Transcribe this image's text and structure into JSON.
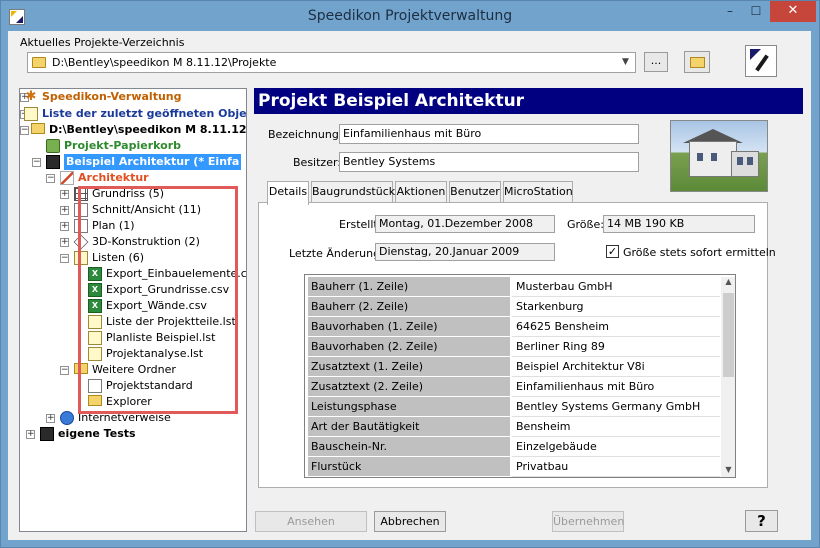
{
  "window": {
    "title": "Speedikon Projektverwaltung",
    "minimize": "–",
    "maximize": "☐",
    "close": "✕"
  },
  "directory": {
    "label": "Aktuelles Projekte-Verzeichnis",
    "path": "D:\\Bentley\\speedikon M 8.11.12\\Projekte",
    "browse_label": "..."
  },
  "tree": {
    "nodes": [
      {
        "label": "Speedikon-Verwaltung",
        "color": "#c06000",
        "bold": true,
        "icon": "star-icon",
        "expander": "+"
      },
      {
        "label": "Liste der zuletzt geöffneten Obje",
        "color": "#1a3a9a",
        "bold": true,
        "icon": "recent-list-icon",
        "expander": "+"
      },
      {
        "label": "D:\\Bentley\\speedikon M 8.11.12",
        "color": "#000000",
        "bold": true,
        "icon": "folder-icon",
        "expander": "−"
      },
      {
        "label": "Projekt-Papierkorb",
        "color": "#2e8a2e",
        "bold": true,
        "icon": "basket-icon",
        "expander": ""
      },
      {
        "label": "Beispiel Architektur   (* Einfa",
        "color": "#ffffff",
        "bold": true,
        "icon": "book-icon",
        "expander": "−",
        "selected": true
      },
      {
        "label": "Architektur",
        "color": "#e05020",
        "bold": true,
        "icon": "pen-icon",
        "expander": "−"
      },
      {
        "label": "Grundriss (5)",
        "icon": "floorplan-icon",
        "expander": "+"
      },
      {
        "label": "Schnitt/Ansicht (11)",
        "icon": "section-icon",
        "expander": "+"
      },
      {
        "label": "Plan (1)",
        "icon": "plan-icon",
        "expander": "+"
      },
      {
        "label": "3D-Konstruktion (2)",
        "icon": "cube-icon",
        "expander": "+"
      },
      {
        "label": "Listen  (6)",
        "icon": "list-folder-icon",
        "expander": "−"
      },
      {
        "label": "Export_Einbauelemente.csv",
        "icon": "excel-icon",
        "expander": ""
      },
      {
        "label": "Export_Grundrisse.csv",
        "icon": "excel-icon",
        "expander": ""
      },
      {
        "label": "Export_Wände.csv",
        "icon": "excel-icon",
        "expander": ""
      },
      {
        "label": "Liste der Projektteile.lst",
        "icon": "list-file-icon",
        "expander": ""
      },
      {
        "label": "Planliste Beispiel.lst",
        "icon": "list-file-icon",
        "expander": ""
      },
      {
        "label": "Projektanalyse.lst",
        "icon": "list-file-icon",
        "expander": ""
      },
      {
        "label": "Weitere Ordner",
        "icon": "folder-icon",
        "expander": "−"
      },
      {
        "label": "Projektstandard",
        "icon": "document-icon",
        "expander": ""
      },
      {
        "label": "Explorer",
        "icon": "folder-open-icon",
        "expander": ""
      },
      {
        "label": "Internetverweise",
        "icon": "globe-icon",
        "expander": "+"
      },
      {
        "label": "eigene Tests",
        "bold": true,
        "icon": "book-icon",
        "expander": "+"
      }
    ]
  },
  "project": {
    "header": "Projekt  Beispiel Architektur",
    "bezeichnung_label": "Bezeichnung:",
    "bezeichnung": "Einfamilienhaus mit Büro",
    "besitzer_label": "Besitzer:",
    "besitzer": "Bentley Systems"
  },
  "tabs": [
    "Details",
    "Baugrundstück",
    "Aktionen",
    "Benutzer",
    "MicroStation"
  ],
  "details": {
    "erstellt_label": "Erstellt:",
    "erstellt": "Montag, 01.Dezember 2008",
    "groesse_label": "Größe:",
    "groesse": "14 MB 190 KB",
    "aenderung_label": "Letzte Änderung:",
    "aenderung": "Dienstag, 20.Januar 2009",
    "checkbox_label": "Größe stets sofort ermitteln",
    "checkbox_mark": "✓",
    "rows": [
      {
        "key": "Bauherr  (1. Zeile)",
        "value": "Musterbau GmbH"
      },
      {
        "key": "Bauherr  (2. Zeile)",
        "value": "Starkenburg"
      },
      {
        "key": "Bauvorhaben (1. Zeile)",
        "value": "64625 Bensheim"
      },
      {
        "key": "Bauvorhaben (2. Zeile)",
        "value": "Berliner Ring 89"
      },
      {
        "key": "Zusatztext (1. Zeile)",
        "value": "Beispiel Architektur V8i"
      },
      {
        "key": "Zusatztext (2. Zeile)",
        "value": "Einfamilienhaus mit Büro"
      },
      {
        "key": "Leistungsphase",
        "value": "Bentley Systems Germany GmbH"
      },
      {
        "key": "Art der Bautätigkeit",
        "value": "Bensheim"
      },
      {
        "key": "Bauschein-Nr.",
        "value": "Einzelgebäude"
      },
      {
        "key": "Flurstück",
        "value": "Privatbau"
      }
    ]
  },
  "buttons": {
    "ansehen": "Ansehen",
    "abbrechen": "Abbrechen",
    "uebernehmen": "Übernehmen",
    "help": "?"
  }
}
